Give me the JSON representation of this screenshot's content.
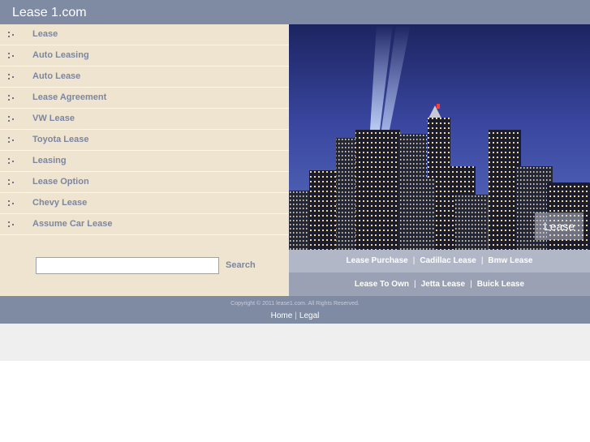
{
  "header": {
    "site_title": "Lease 1.com"
  },
  "sidebar": {
    "items": [
      {
        "label": "Lease"
      },
      {
        "label": "Auto Leasing"
      },
      {
        "label": "Auto Lease"
      },
      {
        "label": "Lease Agreement"
      },
      {
        "label": "VW Lease"
      },
      {
        "label": "Toyota Lease"
      },
      {
        "label": "Leasing"
      },
      {
        "label": "Lease Option"
      },
      {
        "label": "Chevy Lease"
      },
      {
        "label": "Assume Car Lease"
      }
    ]
  },
  "search": {
    "value": "",
    "button_label": "Search"
  },
  "hero": {
    "badge_label": "Lease"
  },
  "links": {
    "row1": [
      "Lease Purchase",
      "Cadillac Lease",
      "Bmw Lease"
    ],
    "row2": [
      "Lease To Own",
      "Jetta Lease",
      "Buick Lease"
    ],
    "separator": "|"
  },
  "footer": {
    "copyright": "Copyright © 2011 lease1.com. All Rights Reserved.",
    "home_label": "Home",
    "legal_label": "Legal",
    "separator": "|"
  },
  "colors": {
    "header_bg": "#7f8aa3",
    "sidebar_bg": "#efe4d0",
    "nav_text": "#7c86a0",
    "links_row1_bg": "#b2b7c7",
    "links_row2_bg": "#9aa1b4"
  }
}
